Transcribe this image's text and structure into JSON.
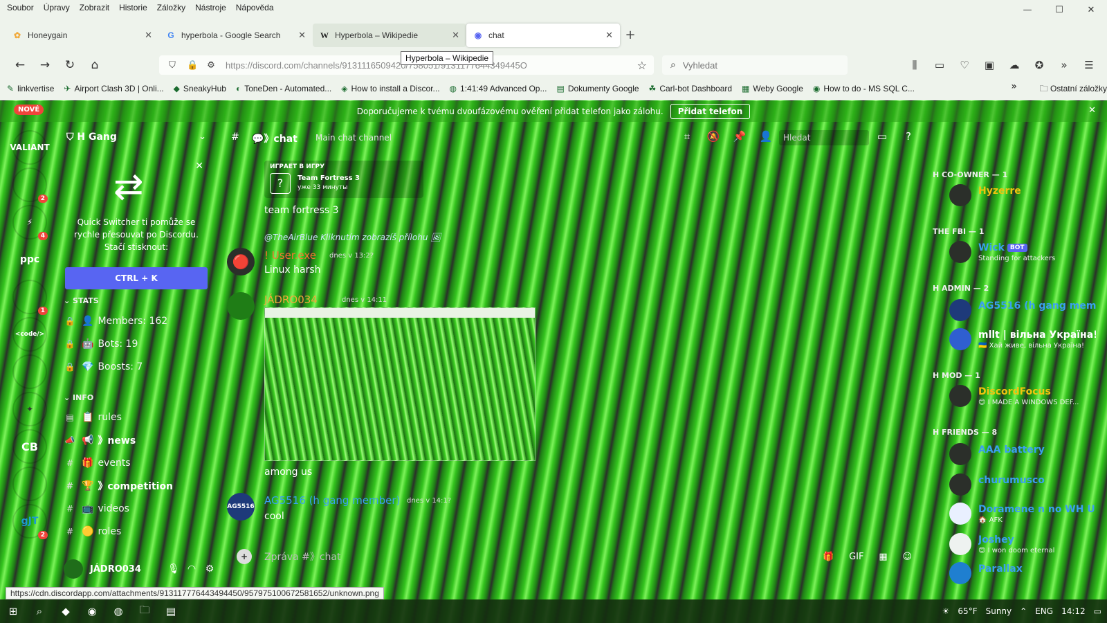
{
  "menubar": [
    "Soubor",
    "Úpravy",
    "Zobrazit",
    "Historie",
    "Záložky",
    "Nástroje",
    "Nápověda"
  ],
  "window_controls": [
    "—",
    "☐",
    "✕"
  ],
  "tabs": [
    {
      "label": "Honeygain",
      "icon": "honeygain-icon",
      "glyph": "✿"
    },
    {
      "label": "hyperbola - Google Search",
      "icon": "google-icon",
      "glyph": "G"
    },
    {
      "label": "Hyperbola – Wikipedie",
      "icon": "wikipedia-icon",
      "glyph": "W"
    },
    {
      "label": "chat",
      "icon": "discord-icon",
      "glyph": "◉"
    }
  ],
  "tooltip": "Hyperbola – Wikipedie",
  "url": "https://discord.com/channels/9131116509420/758051/9131177644349445O",
  "search_placeholder": "Vyhledat",
  "bookmarks": [
    {
      "label": "linkvertise",
      "glyph": "✎"
    },
    {
      "label": "Airport Clash 3D | Onli...",
      "glyph": "✈"
    },
    {
      "label": "SneakyHub",
      "glyph": "◆"
    },
    {
      "label": "ToneDen - Automated...",
      "glyph": "◐"
    },
    {
      "label": "How to install a Discor...",
      "glyph": "◈"
    },
    {
      "label": "1:41:49 Advanced Op...",
      "glyph": "◍"
    },
    {
      "label": "Dokumenty Google",
      "glyph": "▤"
    },
    {
      "label": "Carl-bot Dashboard",
      "glyph": "☘"
    },
    {
      "label": "Weby Google",
      "glyph": "▦"
    },
    {
      "label": "How to do - MS SQL C...",
      "glyph": "◉"
    }
  ],
  "bookmarks_other": "Ostatní záložky",
  "notice": {
    "text": "Doporučujeme k tvému dvoufázovému ověření přidat telefon jako zálohu.",
    "button": "Přidat telefon"
  },
  "guilds": {
    "new_label": "NOVÉ",
    "items": [
      {
        "label": "VALIANT",
        "color": "#1d6fb8",
        "badge": ""
      },
      {
        "label": "",
        "color": "#2b2f2a",
        "badge": "2"
      },
      {
        "label": "⚡",
        "color": "#2b63d6",
        "badge": "4"
      },
      {
        "label": "ppc",
        "color": "transparent",
        "badge": ""
      },
      {
        "label": "",
        "color": "#2b2f2a",
        "badge": "1"
      },
      {
        "label": "<code/>",
        "color": "#2a8bd6",
        "badge": ""
      },
      {
        "label": "",
        "color": "#4a7ad6",
        "badge": ""
      },
      {
        "label": "✦",
        "color": "#e9e9e9",
        "badge": ""
      },
      {
        "label": "CB",
        "color": "#1c9bd1",
        "badge": ""
      },
      {
        "label": "",
        "color": "#3a86c9",
        "badge": ""
      },
      {
        "label": "gJT",
        "color": "#f0f0f0",
        "badge": "2"
      }
    ]
  },
  "server": {
    "name": "H Gang",
    "quick_switcher_text": "Quick Switcher ti pomůže se rychle přesouvat po Discordu. Stačí stisknout:",
    "shortcut": "CTRL + K",
    "categories": [
      {
        "name": "STATS",
        "channels": [
          {
            "emoji": "👤",
            "name": "Members: 162",
            "locked": true
          },
          {
            "emoji": "🤖",
            "name": "Bots: 19",
            "locked": true
          },
          {
            "emoji": "💎",
            "name": "Boosts: 7",
            "locked": true
          }
        ]
      },
      {
        "name": "INFO",
        "channels": [
          {
            "emoji": "📋",
            "name": "rules",
            "locked": false
          },
          {
            "emoji": "📢",
            "name": "》news",
            "locked": false,
            "bold": true
          },
          {
            "emoji": "🎁",
            "name": "events",
            "locked": false
          },
          {
            "emoji": "🏆",
            "name": "》competition",
            "locked": false,
            "bold": true
          },
          {
            "emoji": "📺",
            "name": "videos",
            "locked": false
          },
          {
            "emoji": "🟡",
            "name": "roles",
            "locked": false
          }
        ]
      }
    ]
  },
  "user": {
    "name": "JÁDRO034"
  },
  "channel": {
    "name": "》chat",
    "topic": "Main chat channel"
  },
  "header_search": "Hledat",
  "messages": {
    "activity": {
      "label": "ИГРАЕТ В ИГРУ",
      "game": "Team Fortress 3",
      "time": "уже 33 минуты"
    },
    "text_tf": "team fortress 3",
    "reply": {
      "author": "@TheAirBlue",
      "text": "Kliknutím zobrazíš přílohu"
    },
    "user_exe": {
      "name": "! User.exe",
      "color": "#f57731",
      "time": "dnes v 13:2?",
      "text": "Linux harsh"
    },
    "jadro": {
      "name": "JÁDRO034",
      "color": "#f1a93b",
      "time": "dnes v 14:11"
    },
    "text_among": "among us",
    "ag": {
      "name": "AG5516 (h gang member)",
      "color": "#3aa0f0",
      "time": "dnes v 14:1?",
      "text": "cool",
      "avatar": "AG5516"
    }
  },
  "composer_placeholder": "Zpráva #》chat",
  "members": {
    "groups": [
      {
        "title": "H CO-OWNER — 1",
        "members": [
          {
            "name": "Hyzerre",
            "status": "",
            "color": "#f1c40f",
            "bot": false
          }
        ]
      },
      {
        "title": "THE FBI — 1",
        "members": [
          {
            "name": "Wick",
            "status": "Standing for attackers",
            "color": "#3aa0f0",
            "bot": true
          }
        ]
      },
      {
        "title": "H ADMIN — 2",
        "members": [
          {
            "name": "AG5516 (h gang mem...",
            "status": "",
            "color": "#3aa0f0",
            "bot": false
          },
          {
            "name": "mllt | вільна Україна!",
            "status": "🇺🇦 Хай живе, вільна Україна!",
            "color": "#ffffff",
            "bot": false
          }
        ]
      },
      {
        "title": "H MOD — 1",
        "members": [
          {
            "name": "DiscordFocus",
            "status": "😊 I MADE A WINDOWS DEF...",
            "color": "#f1c40f",
            "bot": false
          }
        ]
      },
      {
        "title": "H FRIENDS — 8",
        "members": [
          {
            "name": "AAA battery",
            "status": "",
            "color": "#3aa0f0",
            "bot": false
          },
          {
            "name": "churumusco",
            "status": "",
            "color": "#3aa0f0",
            "bot": false
          },
          {
            "name": "Doramene n no WH U...",
            "status": "🏠 AFK",
            "color": "#3aa0f0",
            "bot": false
          },
          {
            "name": "Joshey",
            "status": "😊 I won doom eternal",
            "color": "#3aa0f0",
            "bot": false
          },
          {
            "name": "Parallax",
            "status": "",
            "color": "#3aa0f0",
            "bot": false
          }
        ]
      }
    ]
  },
  "statusbar_url": "https://cdn.discordapp.com/attachments/913117776443494450/957975100672581652/unknown.png",
  "taskbar": {
    "weather": "65°F",
    "weather_text": "Sunny",
    "lang": "ENG",
    "time": "14:12"
  }
}
